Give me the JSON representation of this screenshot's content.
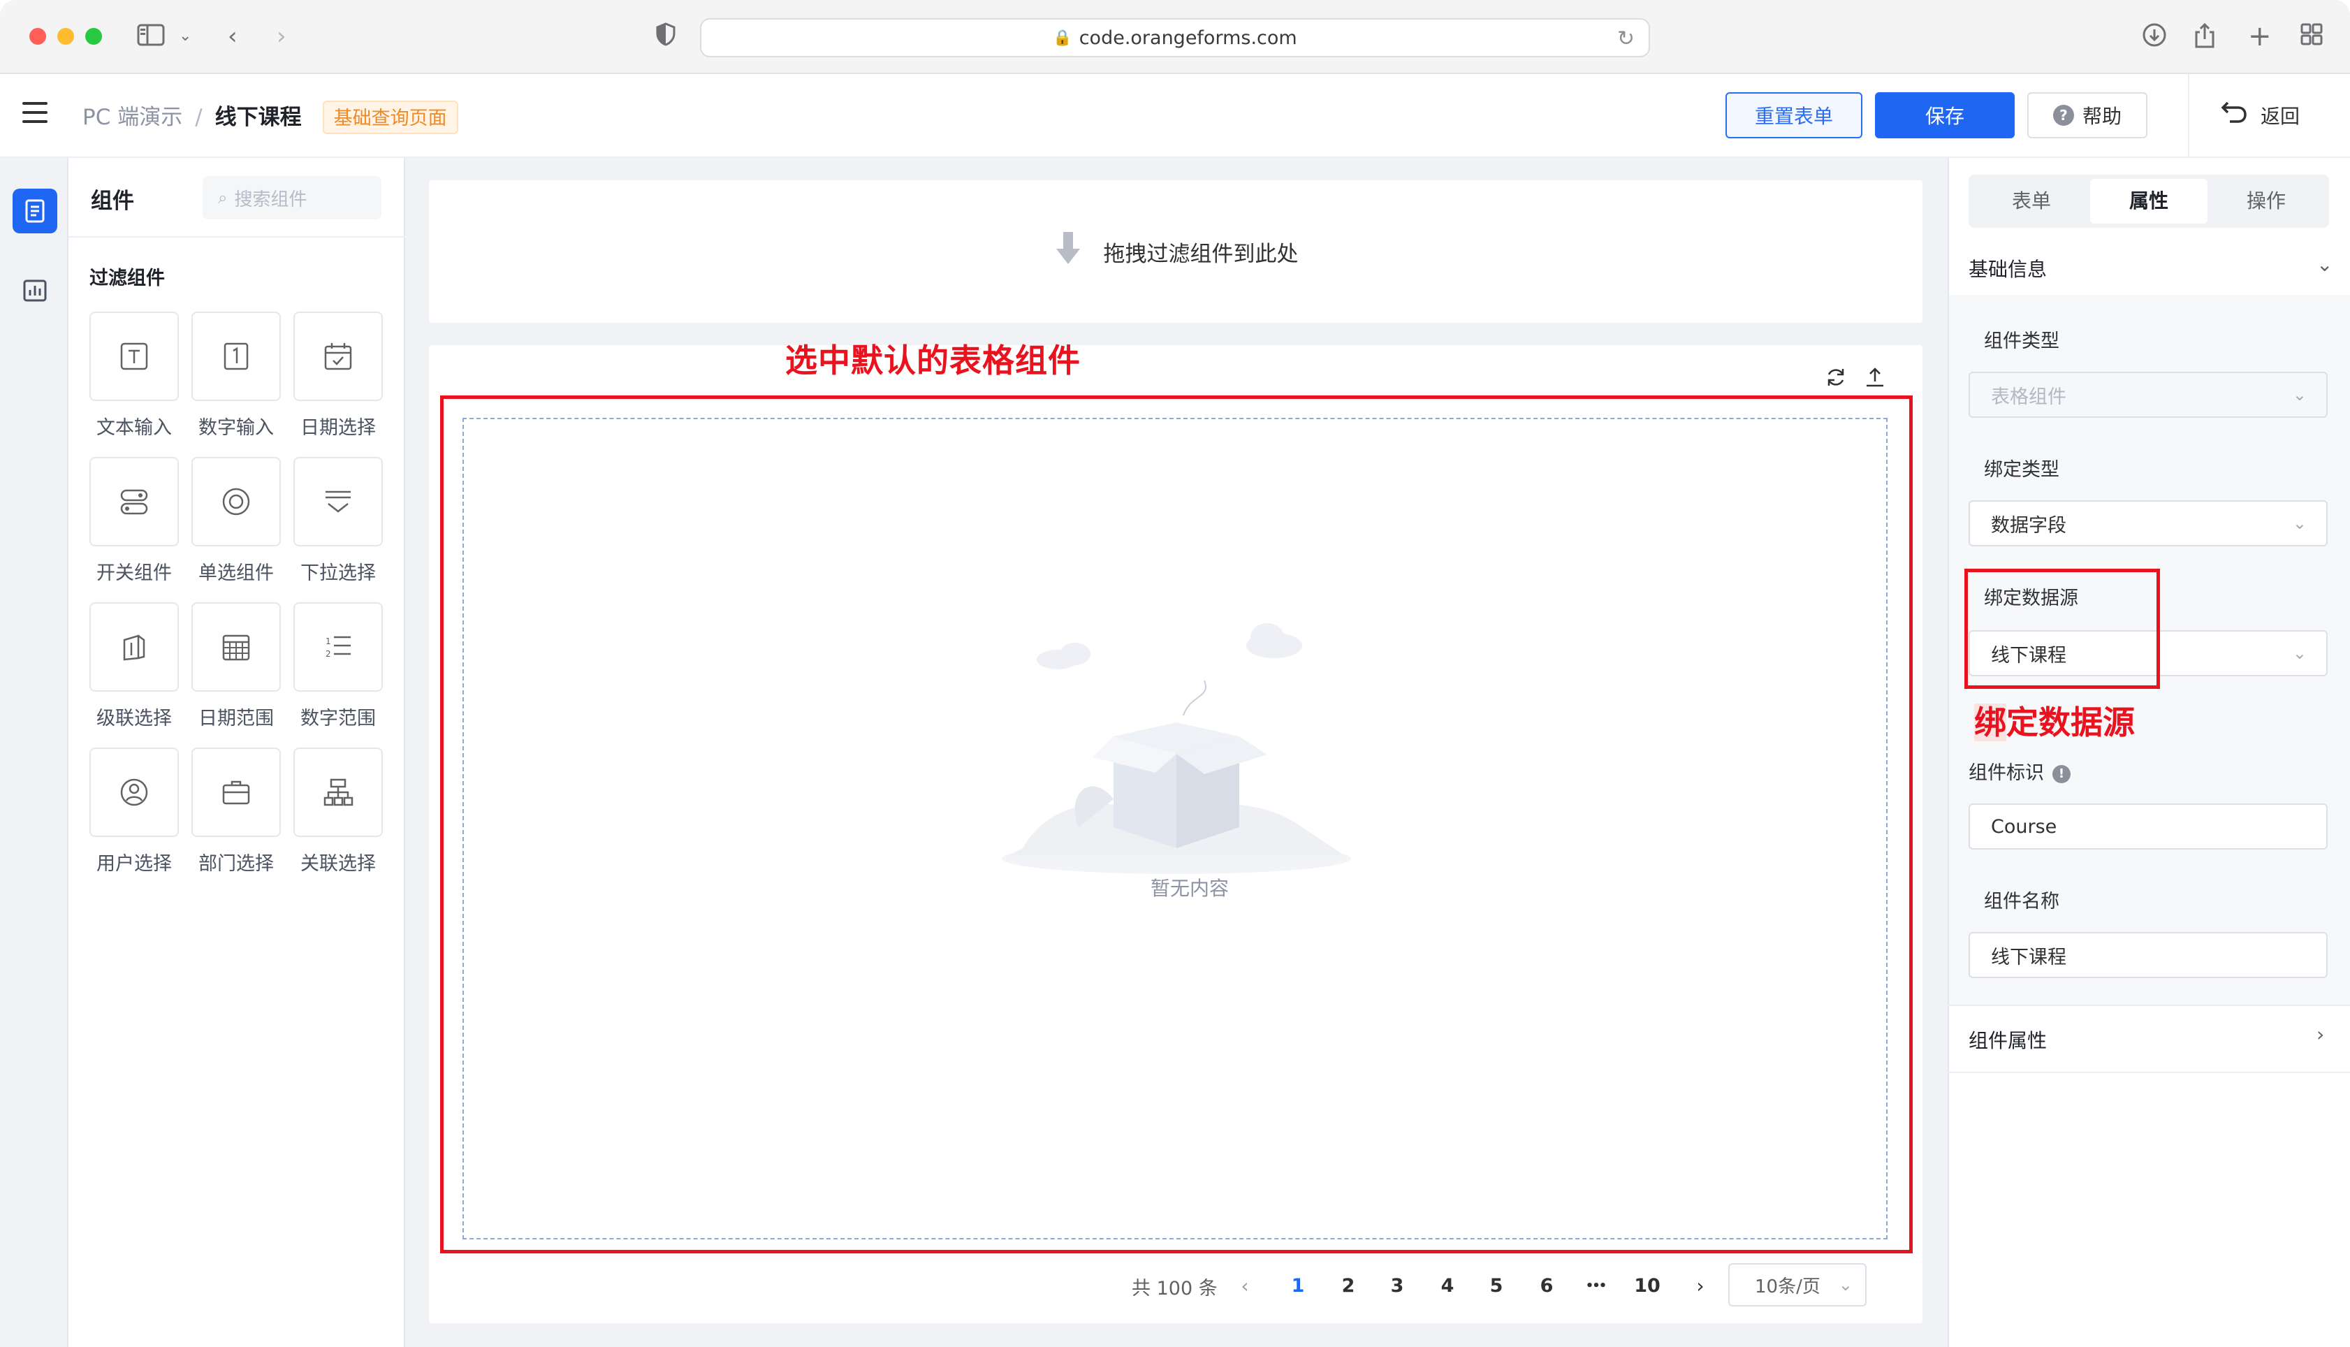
{
  "browser": {
    "url": "code.orangeforms.com"
  },
  "header": {
    "breadcrumb": [
      "PC 端演示",
      "线下课程"
    ],
    "breadcrumb_separator": "/",
    "page_tag": "基础查询页面",
    "buttons": {
      "reset": "重置表单",
      "save": "保存",
      "help": "帮助",
      "back": "返回"
    }
  },
  "components_panel": {
    "title": "组件",
    "search_placeholder": "搜索组件",
    "section_title": "过滤组件",
    "items": [
      {
        "label": "文本输入",
        "icon": "text-input-icon"
      },
      {
        "label": "数字输入",
        "icon": "number-input-icon"
      },
      {
        "label": "日期选择",
        "icon": "date-picker-icon"
      },
      {
        "label": "开关组件",
        "icon": "switch-icon"
      },
      {
        "label": "单选组件",
        "icon": "radio-icon"
      },
      {
        "label": "下拉选择",
        "icon": "dropdown-icon"
      },
      {
        "label": "级联选择",
        "icon": "cascader-icon"
      },
      {
        "label": "日期范围",
        "icon": "date-range-icon"
      },
      {
        "label": "数字范围",
        "icon": "number-range-icon"
      },
      {
        "label": "用户选择",
        "icon": "user-select-icon"
      },
      {
        "label": "部门选择",
        "icon": "department-select-icon"
      },
      {
        "label": "关联选择",
        "icon": "relation-select-icon"
      }
    ]
  },
  "canvas": {
    "filter_drop_hint": "拖拽过滤组件到此处",
    "annotation": "选中默认的表格组件",
    "empty_text": "暂无内容",
    "pagination": {
      "total": "共 100 条",
      "pages": [
        "1",
        "2",
        "3",
        "4",
        "5",
        "6"
      ],
      "ellipsis": "•••",
      "last_page": "10",
      "current_page": "1",
      "page_size": "10条/页"
    }
  },
  "properties": {
    "tabs": [
      "表单",
      "属性",
      "操作"
    ],
    "active_tab": "属性",
    "basic_section": "基础信息",
    "component_type_label": "组件类型",
    "component_type_value": "表格组件",
    "bind_type_label": "绑定类型",
    "bind_type_value": "数据字段",
    "bind_source_label": "绑定数据源",
    "bind_source_value": "线下课程",
    "bind_source_annotation_hl": "绑",
    "bind_source_annotation_rest": "定数据源",
    "component_id_label": "组件标识",
    "component_id_value": "Course",
    "component_name_label": "组件名称",
    "component_name_value": "线下课程",
    "attributes_section": "组件属性"
  },
  "colors": {
    "primary": "#1f66f2",
    "annotation_red": "#e8131e",
    "tag_orange": "#f08a24"
  }
}
